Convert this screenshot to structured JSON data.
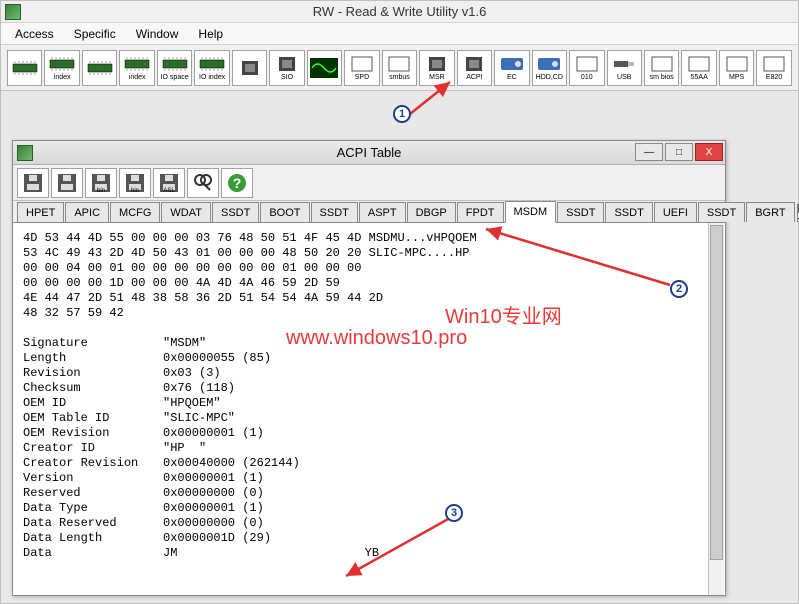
{
  "app": {
    "title": "RW - Read & Write Utility v1.6"
  },
  "menu": {
    "items": [
      "Access",
      "Specific",
      "Window",
      "Help"
    ]
  },
  "main_toolbar": [
    {
      "name": "mem-icon",
      "label": ""
    },
    {
      "name": "index-icon",
      "label": "index"
    },
    {
      "name": "mem2-icon",
      "label": ""
    },
    {
      "name": "index2-icon",
      "label": "index"
    },
    {
      "name": "io-space-icon",
      "label": "IO space"
    },
    {
      "name": "io-index-icon",
      "label": "IO index"
    },
    {
      "name": "pci-icon",
      "label": ""
    },
    {
      "name": "sio-icon",
      "label": "SIO"
    },
    {
      "name": "wave-icon",
      "label": ""
    },
    {
      "name": "spd-icon",
      "label": "SPD"
    },
    {
      "name": "smbus-icon",
      "label": "smbus"
    },
    {
      "name": "msr-icon",
      "label": "MSR"
    },
    {
      "name": "acpi-icon",
      "label": "ACPI"
    },
    {
      "name": "ec-icon",
      "label": "EC"
    },
    {
      "name": "hdd-icon",
      "label": "HDD,CD"
    },
    {
      "name": "010-icon",
      "label": "010"
    },
    {
      "name": "usb-icon",
      "label": "USB"
    },
    {
      "name": "smbios-icon",
      "label": "sm bios"
    },
    {
      "name": "55aa-icon",
      "label": "55AA"
    },
    {
      "name": "mps-icon",
      "label": "MPS"
    },
    {
      "name": "e820-icon",
      "label": "E820"
    }
  ],
  "sub_window": {
    "title": "ACPI Table",
    "controls": {
      "min": "—",
      "max": "□",
      "close": "X"
    },
    "toolbar": [
      {
        "name": "save-icon"
      },
      {
        "name": "save-all-icon"
      },
      {
        "name": "bin-icon",
        "txt": "bin"
      },
      {
        "name": "bin-all-icon",
        "txt": "bin"
      },
      {
        "name": "asl-icon",
        "txt": "ASL"
      },
      {
        "name": "find-icon"
      },
      {
        "name": "help-icon"
      }
    ],
    "tabs": [
      "HPET",
      "APIC",
      "MCFG",
      "WDAT",
      "SSDT",
      "BOOT",
      "SSDT",
      "ASPT",
      "DBGP",
      "FPDT",
      "MSDM",
      "SSDT",
      "SSDT",
      "UEFI",
      "SSDT",
      "BGRT"
    ],
    "active_tab": "MSDM",
    "nav_left": "|◀",
    "nav_right": "▶"
  },
  "hex_dump": [
    "4D 53 44 4D 55 00 00 00 03 76 48 50 51 4F 45 4D MSDMU...vHPQOEM",
    "53 4C 49 43 2D 4D 50 43 01 00 00 00 48 50 20 20 SLIC-MPC....HP",
    "00 00 04 00 01 00 00 00 00 00 00 00 01 00 00 00",
    "00 00 00 00 1D 00 00 00 4A 4D 4A 46 59 2D 59",
    "4E 44 47 2D 51 48 38 58 36 2D 51 54 54 4A 59 44 2D",
    "48 32 57 59 42"
  ],
  "fields": [
    {
      "lbl": "Signature",
      "val": "\"MSDM\""
    },
    {
      "lbl": "Length",
      "val": "0x00000055 (85)"
    },
    {
      "lbl": "Revision",
      "val": "0x03 (3)"
    },
    {
      "lbl": "Checksum",
      "val": "0x76 (118)"
    },
    {
      "lbl": "OEM ID",
      "val": "\"HPQOEM\""
    },
    {
      "lbl": "OEM Table ID",
      "val": "\"SLIC-MPC\""
    },
    {
      "lbl": "OEM Revision",
      "val": "0x00000001 (1)"
    },
    {
      "lbl": "Creator ID",
      "val": "\"HP  \""
    },
    {
      "lbl": "Creator Revision",
      "val": "0x00040000 (262144)"
    },
    {
      "lbl": "Version",
      "val": "0x00000001 (1)"
    },
    {
      "lbl": "Reserved",
      "val": "0x00000000 (0)"
    },
    {
      "lbl": "Data Type",
      "val": "0x00000001 (1)"
    },
    {
      "lbl": "Data Reserved",
      "val": "0x00000000 (0)"
    },
    {
      "lbl": "Data Length",
      "val": "0x0000001D (29)"
    },
    {
      "lbl": "Data",
      "val": "JM                          YB"
    }
  ],
  "watermark": {
    "line1": "Win10专业网",
    "line2": "www.windows10.pro"
  },
  "badges": {
    "b1": "1",
    "b2": "2",
    "b3": "3"
  }
}
